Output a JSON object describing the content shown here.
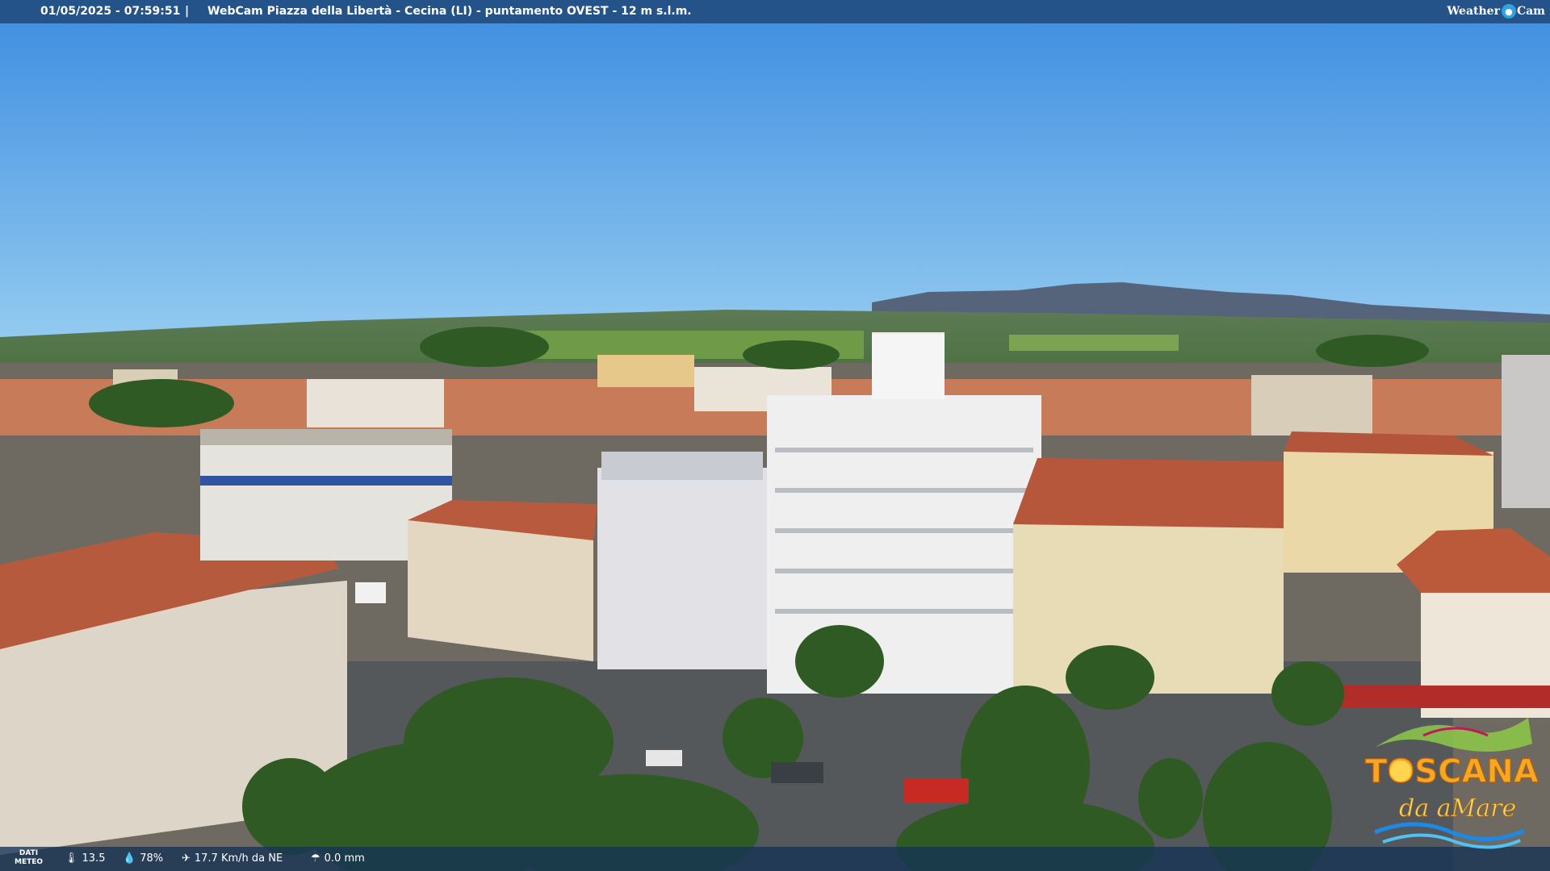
{
  "header": {
    "timestamp": "01/05/2025 - 07:59:51",
    "separator": "|",
    "title": "WebCam Piazza della Libertà - Cecina (LI) - puntamento OVEST - 12 m s.l.m.",
    "brand_left": "Weather",
    "brand_right": "Cam"
  },
  "weather": {
    "label_line1": "DATI",
    "label_line2": "METEO",
    "temperature": "13.5",
    "humidity": "78%",
    "wind": "17.7 Km/h da NE",
    "rain": "0.0 mm"
  },
  "logo": {
    "line1": "TOSCANA",
    "line2": "da aMare"
  },
  "colors": {
    "sky_top": "#3e8fe0",
    "sky_horizon": "#8ec6ef",
    "header_bar": "#24538a",
    "roof": "#b85a3e"
  }
}
